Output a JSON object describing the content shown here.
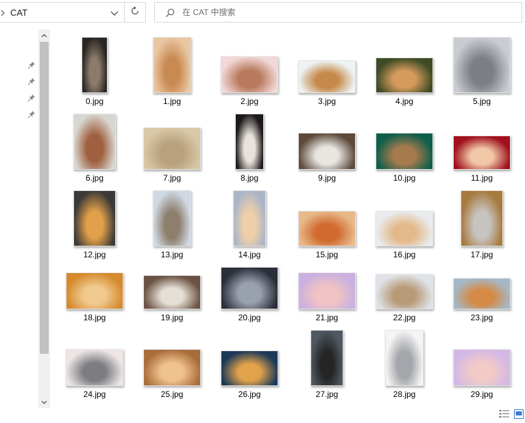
{
  "address_bar": {
    "path_label": "CAT"
  },
  "search": {
    "placeholder": "在 CAT 中搜索"
  },
  "files": [
    {
      "name": "0.jpg",
      "c1": "#2b2623",
      "c2": "#8a7b6b"
    },
    {
      "name": "1.jpg",
      "c1": "#e9c7a3",
      "c2": "#c98a52"
    },
    {
      "name": "2.jpg",
      "c1": "#f1d7d6",
      "c2": "#b87a5e"
    },
    {
      "name": "3.jpg",
      "c1": "#eef3f5",
      "c2": "#c58a4a"
    },
    {
      "name": "4.jpg",
      "c1": "#3f4b25",
      "c2": "#d59b5c"
    },
    {
      "name": "5.jpg",
      "c1": "#c9ccd2",
      "c2": "#7c7f86"
    },
    {
      "name": "6.jpg",
      "c1": "#d8d6d0",
      "c2": "#a0603f"
    },
    {
      "name": "7.jpg",
      "c1": "#d9c7a7",
      "c2": "#b8a17c"
    },
    {
      "name": "8.jpg",
      "c1": "#1e1a1a",
      "c2": "#e7e2dc"
    },
    {
      "name": "9.jpg",
      "c1": "#5d4a3c",
      "c2": "#e9e6e2"
    },
    {
      "name": "10.jpg",
      "c1": "#0f5e4a",
      "c2": "#a67a4d"
    },
    {
      "name": "11.jpg",
      "c1": "#a1101c",
      "c2": "#f0c8a6"
    },
    {
      "name": "12.jpg",
      "c1": "#3c3a38",
      "c2": "#e2a04a"
    },
    {
      "name": "13.jpg",
      "c1": "#cfd9e4",
      "c2": "#8e7e6c"
    },
    {
      "name": "14.jpg",
      "c1": "#aab6c8",
      "c2": "#efcfa8"
    },
    {
      "name": "15.jpg",
      "c1": "#e8b98a",
      "c2": "#d06a2e"
    },
    {
      "name": "16.jpg",
      "c1": "#e9ecef",
      "c2": "#e3b98a"
    },
    {
      "name": "17.jpg",
      "c1": "#a77a3e",
      "c2": "#c7c3bf"
    },
    {
      "name": "18.jpg",
      "c1": "#d58a2d",
      "c2": "#f0c98e"
    },
    {
      "name": "19.jpg",
      "c1": "#6b5242",
      "c2": "#e5dfd6"
    },
    {
      "name": "20.jpg",
      "c1": "#2b2f3a",
      "c2": "#9aa1ae"
    },
    {
      "name": "21.jpg",
      "c1": "#c9b0e0",
      "c2": "#f1c3c3"
    },
    {
      "name": "22.jpg",
      "c1": "#dfe3e8",
      "c2": "#b89a78"
    },
    {
      "name": "23.jpg",
      "c1": "#a6b8c6",
      "c2": "#d58a45"
    },
    {
      "name": "24.jpg",
      "c1": "#ede4e3",
      "c2": "#7b7d82"
    },
    {
      "name": "25.jpg",
      "c1": "#a96d3b",
      "c2": "#f0c28e"
    },
    {
      "name": "26.jpg",
      "c1": "#1c3a58",
      "c2": "#e2a24a"
    },
    {
      "name": "27.jpg",
      "c1": "#505862",
      "c2": "#252526"
    },
    {
      "name": "28.jpg",
      "c1": "#f4f4f4",
      "c2": "#a4a6ab"
    },
    {
      "name": "29.jpg",
      "c1": "#d3b8e6",
      "c2": "#f2cac6"
    }
  ]
}
